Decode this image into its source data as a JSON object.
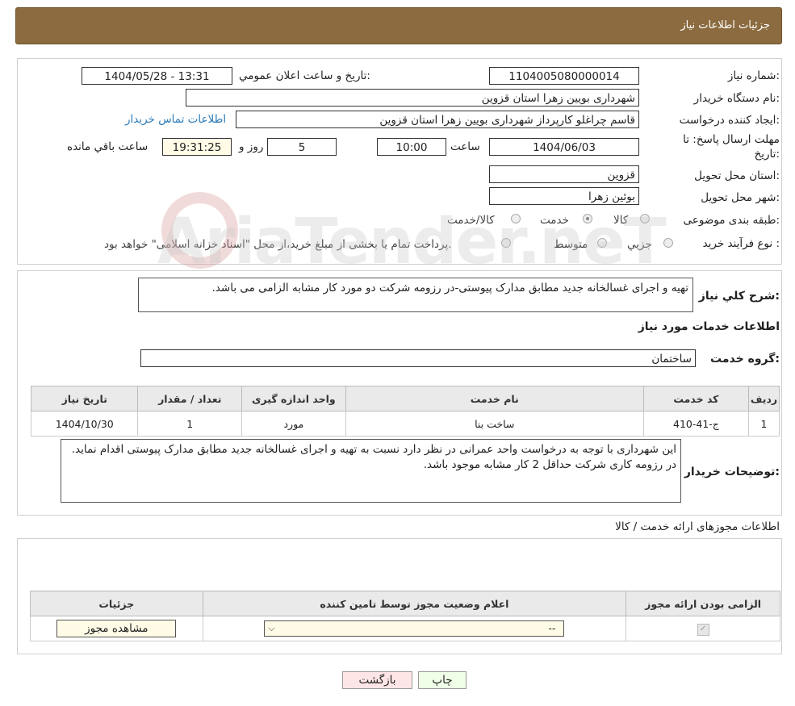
{
  "header": {
    "title": "جزئیات اطلاعات نیاز"
  },
  "form": {
    "need_number_label": "شماره نیاز:",
    "need_number": "1104005080000014",
    "announce_label": "تاریخ و ساعت اعلان عمومي:",
    "announce_value": "1404/05/28 - 13:31",
    "buyer_org_label": "نام دستگاه خريدار:",
    "buyer_org": "شهرداری بویین زهرا استان قزوین",
    "requester_label": "ايجاد کننده درخواست:",
    "requester": "قاسم چراغلو کارپرداز شهرداری بویین زهرا استان قزوین",
    "contact_link": "اطلاعات تماس خريدار",
    "deadline_label_1": "مهلت ارسال پاسخ: تا",
    "deadline_label_2": "تاريخ:",
    "deadline_date": "1404/06/03",
    "time_label": "ساعت",
    "deadline_time": "10:00",
    "days": "5",
    "days_label": "روز و",
    "remaining_time": "19:31:25",
    "remaining_label": "ساعت باقي مانده",
    "province_label": "استان محل تحويل:",
    "province": "قزوین",
    "city_label": "شهر محل تحويل:",
    "city": "بوئین زهرا",
    "category_label": "طبقه بندی موضوعی:",
    "category_options": [
      "کالا",
      "خدمت",
      "کالا/خدمت"
    ],
    "category_selected": "خدمت",
    "process_label": "نوع فرآيند خريد :",
    "process_options": [
      "جزیي",
      "متوسط"
    ],
    "process_note": "پرداخت تمام يا بخشی از مبلغ خريد،از محل \"اسناد خزانه اسلامی\" خواهد بود."
  },
  "summary": {
    "title_label": "شرح کلي نياز:",
    "title_value": "تهیه و اجرای غسالخانه جدید مطابق مدارک پیوستی-در رزومه شرکت دو مورد کار مشابه الزامی می باشد.",
    "services_heading": "اطلاعات خدمات مورد نياز",
    "group_label": "گروه خدمت:",
    "group_value": "ساختمان"
  },
  "services_table": {
    "headers": [
      "رديف",
      "کد خدمت",
      "نام خدمت",
      "واحد اندازه گيری",
      "تعداد / مقدار",
      "تاريخ نياز"
    ],
    "rows": [
      [
        "1",
        "ج-41-410",
        "ساخت بنا",
        "مورد",
        "1",
        "1404/10/30"
      ]
    ]
  },
  "buyer_notes": {
    "label": "توضيحات خريدار:",
    "lines": [
      "اين شهرداری با توجه به درخواست واحد عمرانی در نظر دارد نسبت به تهيه و اجرای غسالخانه جديد مطابق مدارک پيوستی اقدام نمايد.",
      "در رزومه کاری شرکت حداقل 2 کار مشابه موجود باشد."
    ]
  },
  "permits": {
    "heading": "اطلاعات مجوزهای ارائه خدمت / کالا",
    "headers": [
      "الزامی بودن ارائه مجوز",
      "اعلام وضعيت مجوز توسط تامين کننده",
      "جزئيات"
    ],
    "select_value": "--",
    "view_button": "مشاهده مجوز"
  },
  "actions": {
    "print": "چاپ",
    "back": "بازگشت"
  },
  "watermark": "AriaTender.neT"
}
